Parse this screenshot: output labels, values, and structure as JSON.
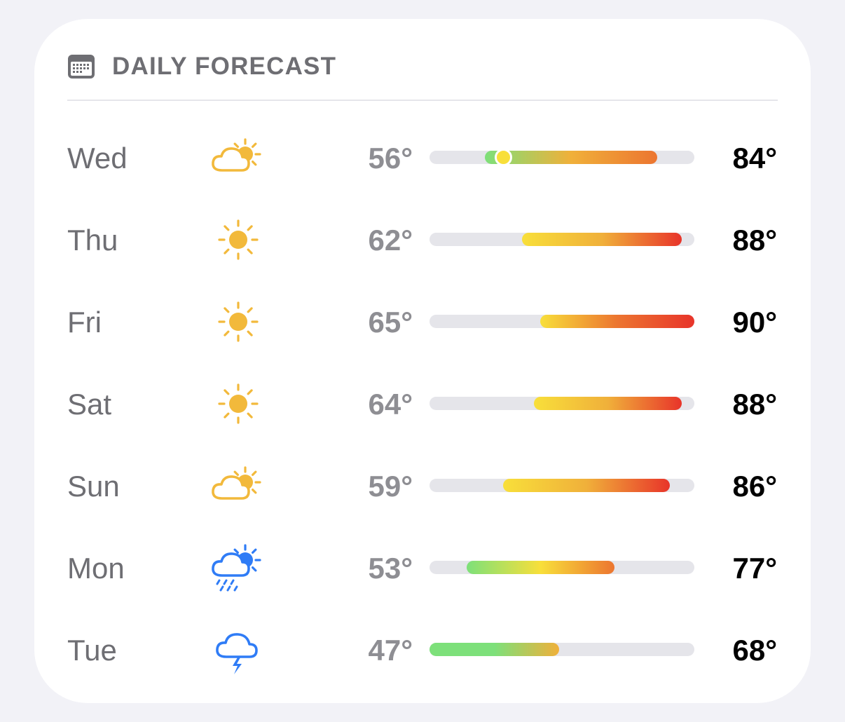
{
  "title": "DAILY FORECAST",
  "title_icon": "calendar-icon",
  "colors": {
    "sun": "#f2b93b",
    "rain": "#2f7cf6",
    "track": "#e5e5ea",
    "cool": "#7de07a",
    "warm": "#f8df3a",
    "hot": "#e8342a"
  },
  "days": [
    {
      "day": "Wed",
      "icon": "partly-cloudy-icon",
      "low": "56°",
      "high": "84°",
      "low_value": 56,
      "high_value": 84,
      "current": 59
    },
    {
      "day": "Thu",
      "icon": "sun-icon",
      "low": "62°",
      "high": "88°",
      "low_value": 62,
      "high_value": 88
    },
    {
      "day": "Fri",
      "icon": "sun-icon",
      "low": "65°",
      "high": "90°",
      "low_value": 65,
      "high_value": 90
    },
    {
      "day": "Sat",
      "icon": "sun-icon",
      "low": "64°",
      "high": "88°",
      "low_value": 64,
      "high_value": 88
    },
    {
      "day": "Sun",
      "icon": "partly-cloudy-icon",
      "low": "59°",
      "high": "86°",
      "low_value": 59,
      "high_value": 86
    },
    {
      "day": "Mon",
      "icon": "rain-sun-icon",
      "low": "53°",
      "high": "77°",
      "low_value": 53,
      "high_value": 77
    },
    {
      "day": "Tue",
      "icon": "thunderstorm-icon",
      "low": "47°",
      "high": "68°",
      "low_value": 47,
      "high_value": 68
    }
  ],
  "range": {
    "min": 47,
    "max": 90
  }
}
